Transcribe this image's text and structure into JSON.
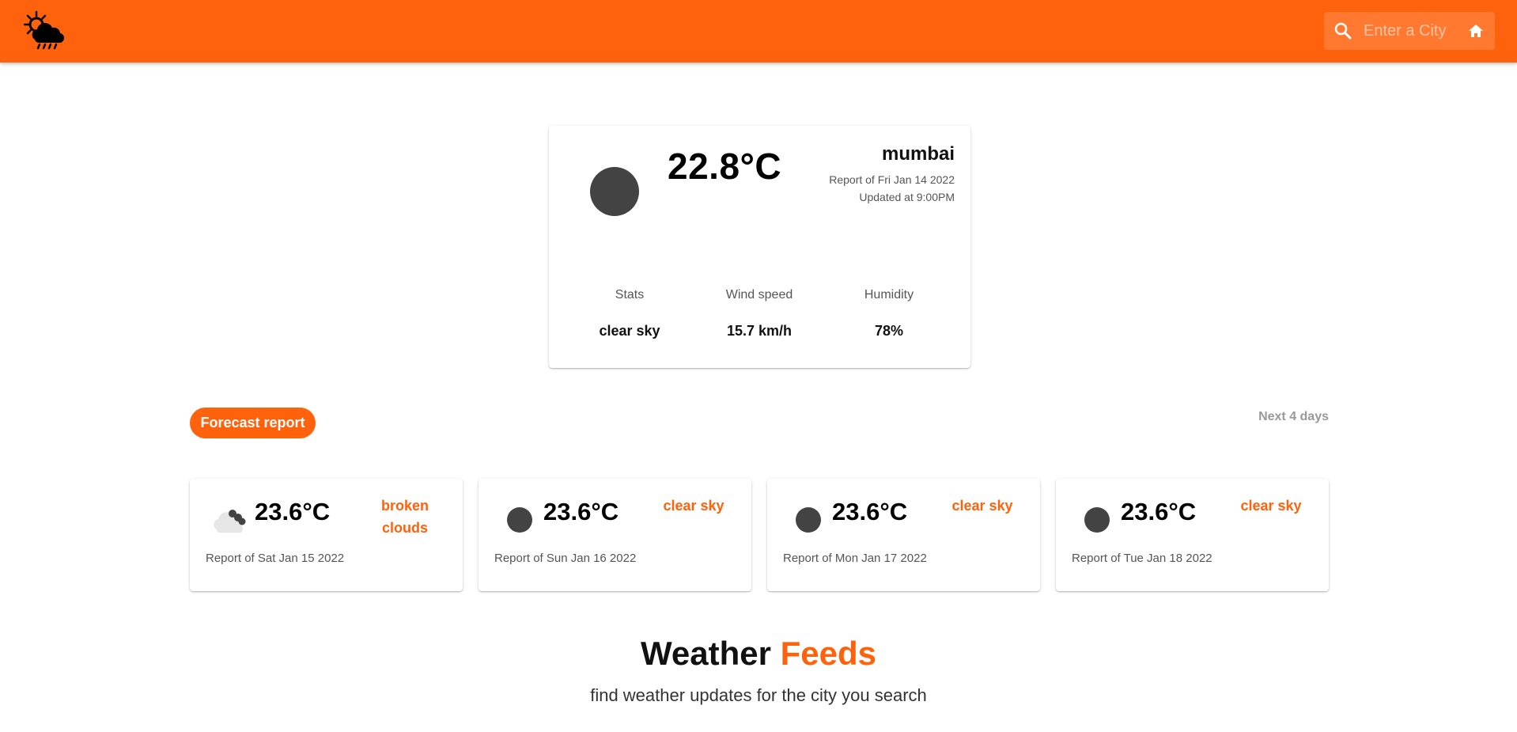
{
  "colors": {
    "brand": "#ff620d",
    "icon_gray": "#434343"
  },
  "header": {
    "logo_icon": "sun-cloud-rain-icon",
    "search": {
      "placeholder": "Enter a City",
      "icon": "search-icon",
      "home_icon": "home-icon"
    }
  },
  "current": {
    "icon": "clear-sky-icon",
    "temperature": "22.8°C",
    "city": "mumbai",
    "report_date": "Report of Fri Jan 14 2022",
    "updated": "Updated at 9:00PM",
    "stats": [
      {
        "label": "Stats",
        "value": "clear sky"
      },
      {
        "label": "Wind speed",
        "value": "15.7 km/h"
      },
      {
        "label": "Humidity",
        "value": "78%"
      }
    ]
  },
  "forecast": {
    "chip_label": "Forecast report",
    "range_label": "Next 4 days",
    "days": [
      {
        "icon": "broken-clouds-icon",
        "temperature": "23.6°C",
        "description": "broken clouds",
        "report": "Report of Sat Jan 15 2022"
      },
      {
        "icon": "clear-sky-icon",
        "temperature": "23.6°C",
        "description": "clear sky",
        "report": "Report of Sun Jan 16 2022"
      },
      {
        "icon": "clear-sky-icon",
        "temperature": "23.6°C",
        "description": "clear sky",
        "report": "Report of Mon Jan 17 2022"
      },
      {
        "icon": "clear-sky-icon",
        "temperature": "23.6°C",
        "description": "clear sky",
        "report": "Report of Tue Jan 18 2022"
      }
    ]
  },
  "feeds": {
    "title_main": "Weather",
    "title_accent": "Feeds",
    "subtitle": "find weather updates for the city you search"
  }
}
